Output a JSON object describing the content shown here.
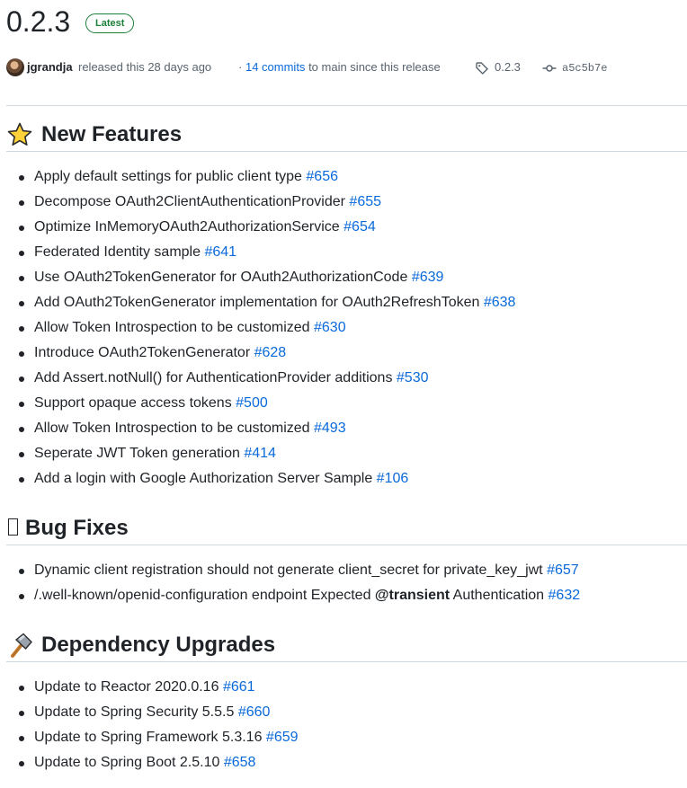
{
  "release": {
    "version": "0.2.3",
    "badge": "Latest",
    "author": "jgrandja",
    "released_text": "released this 28 days ago",
    "commits_prefix": "·",
    "commits_link": "14 commits",
    "commits_suffix": "to main since this release",
    "tag": "0.2.3",
    "commit_hash": "a5c5b7e"
  },
  "sections": [
    {
      "icon": "star-icon",
      "title": "New Features",
      "items": [
        {
          "text": "Apply default settings for public client type",
          "issue": "#656"
        },
        {
          "text": "Decompose OAuth2ClientAuthenticationProvider",
          "issue": "#655"
        },
        {
          "text": "Optimize InMemoryOAuth2AuthorizationService",
          "issue": "#654"
        },
        {
          "text": "Federated Identity sample",
          "issue": "#641"
        },
        {
          "text": "Use OAuth2TokenGenerator for OAuth2AuthorizationCode",
          "issue": "#639"
        },
        {
          "text": "Add OAuth2TokenGenerator implementation for OAuth2RefreshToken",
          "issue": "#638"
        },
        {
          "text": "Allow Token Introspection to be customized",
          "issue": "#630"
        },
        {
          "text": "Introduce OAuth2TokenGenerator",
          "issue": "#628"
        },
        {
          "text": "Add Assert.notNull() for AuthenticationProvider additions",
          "issue": "#530"
        },
        {
          "text": "Support opaque access tokens",
          "issue": "#500"
        },
        {
          "text": "Allow Token Introspection to be customized",
          "issue": "#493"
        },
        {
          "text": "Seperate JWT Token generation",
          "issue": "#414"
        },
        {
          "text": "Add a login with Google Authorization Server Sample",
          "issue": "#106"
        }
      ]
    },
    {
      "icon": "missing-glyph-icon",
      "title": "Bug Fixes",
      "items": [
        {
          "text": "Dynamic client registration should not generate client_secret for private_key_jwt",
          "issue": "#657"
        },
        {
          "text_before": "/.well-known/openid-configuration endpoint Expected",
          "mention": "@transient",
          "text_after": "Authentication",
          "issue": "#632"
        }
      ]
    },
    {
      "icon": "hammer-icon",
      "title": "Dependency Upgrades",
      "items": [
        {
          "text": "Update to Reactor 2020.0.16",
          "issue": "#661"
        },
        {
          "text": "Update to Spring Security 5.5.5",
          "issue": "#660"
        },
        {
          "text": "Update to Spring Framework 5.3.16",
          "issue": "#659"
        },
        {
          "text": "Update to Spring Boot 2.5.10",
          "issue": "#658"
        }
      ]
    }
  ],
  "colors": {
    "link": "#0969da",
    "badge_green": "#1a7f37",
    "text": "#1f2328",
    "muted": "#59636e",
    "border": "#d1d9e0"
  }
}
